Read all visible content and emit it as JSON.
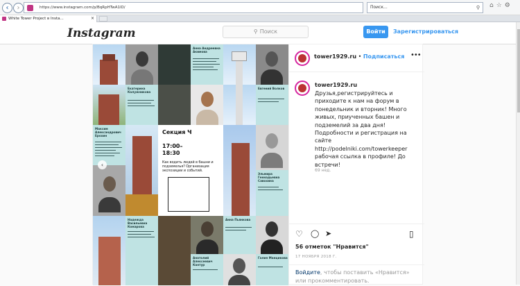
{
  "browser": {
    "url": "https://www.instagram.com/p/BqRpHTwA1lD/",
    "search_placeholder": "Поиск...",
    "tab_title": "White Tower Project в Insta..."
  },
  "header": {
    "logo": "Instagram",
    "search_placeholder": "Поиск",
    "login_label": "Войти",
    "signup_label": "Зарегистрироваться"
  },
  "grid": {
    "names": [
      "Екатерина Калужникова",
      "Анна Андреевна Акимова",
      "Евгений Волков",
      "Максим Александрович Ерохин",
      "Эльмира Геннадьевна Савохина",
      "Надежда Васильевна Комарова",
      "Анна Пьянкова",
      "Анатолий Алексеевич Кантур",
      "Галия Манцикова"
    ],
    "section_title": "Секция Ч",
    "section_time": "17:00– 18:30",
    "section_desc": "Как водить людей в башни и подземелья? Организация экспозиции и событий."
  },
  "post": {
    "username": "tower1929.ru",
    "dot": " • ",
    "follow_label": "Подписаться",
    "more": "•••",
    "caption_user": "tower1929.ru",
    "caption": "Друзья,регистрируйтесь и приходите к нам на форум в понедельник и вторник! Много живых, приученных башен и подземелий за два дня! Подробности и регистрация на сайте http://podelniki.com/towerkeeper рабочая ссылка в профиле! До встречи!",
    "ago": "69 нед.",
    "likes": "56 отметок \"Нравится\"",
    "date": "17 НОЯБРЯ 2018 Г.",
    "login_link": "Войдите",
    "login_text": ", чтобы поставить «Нравится» или прокомментировать."
  },
  "colors": {
    "accent": "#3897f0",
    "teal_card": "#bfe3e3"
  }
}
